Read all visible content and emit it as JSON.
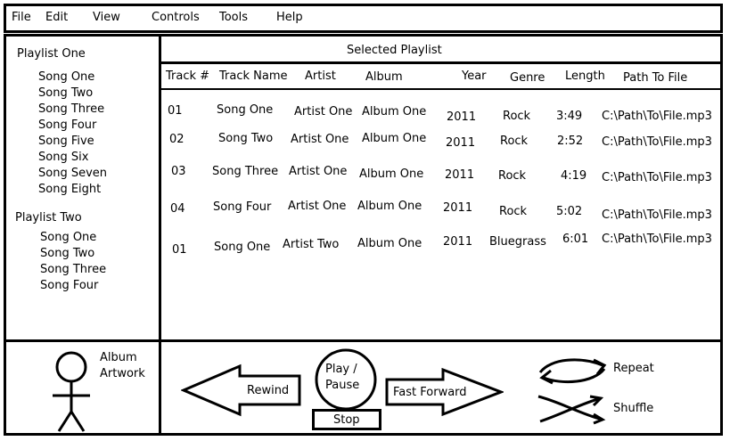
{
  "menu": [
    "File",
    "Edit",
    "View",
    "Controls",
    "Tools",
    "Help"
  ],
  "playlists": [
    {
      "title": "Playlist One",
      "songs": [
        "Song One",
        "Song Two",
        "Song Three",
        "Song Four",
        "Song Five",
        "Song Six",
        "Song Seven",
        "Song Eight"
      ]
    },
    {
      "title": "Playlist Two",
      "songs": [
        "Song One",
        "Song Two",
        "Song Three",
        "Song Four"
      ]
    }
  ],
  "table": {
    "title": "Selected Playlist",
    "headers": [
      "Track #",
      "Track Name",
      "Artist",
      "Album",
      "Year",
      "Genre",
      "Length",
      "Path To File"
    ],
    "rows": [
      [
        "01",
        "Song One",
        "Artist One",
        "Album One",
        "2011",
        "Rock",
        "3:49",
        "C:\\Path\\To\\File.mp3"
      ],
      [
        "02",
        "Song Two",
        "Artist One",
        "Album One",
        "2011",
        "Rock",
        "2:52",
        "C:\\Path\\To\\File.mp3"
      ],
      [
        "03",
        "Song Three",
        "Artist One",
        "Album One",
        "2011",
        "Rock",
        "4:19",
        "C:\\Path\\To\\File.mp3"
      ],
      [
        "04",
        "Song Four",
        "Artist One",
        "Album One",
        "2011",
        "Rock",
        "5:02",
        "C:\\Path\\To\\File.mp3"
      ],
      [
        "01",
        "Song One",
        "Artist Two",
        "Album One",
        "2011",
        "Bluegrass",
        "6:01",
        "C:\\Path\\To\\File.mp3"
      ]
    ]
  },
  "controls": {
    "album_label_1": "Album",
    "album_label_2": "Artwork",
    "rewind": "Rewind",
    "play_line1": "Play /",
    "play_line2": "Pause",
    "stop": "Stop",
    "fast_forward": "Fast Forward",
    "repeat": "Repeat",
    "shuffle": "Shuffle"
  }
}
